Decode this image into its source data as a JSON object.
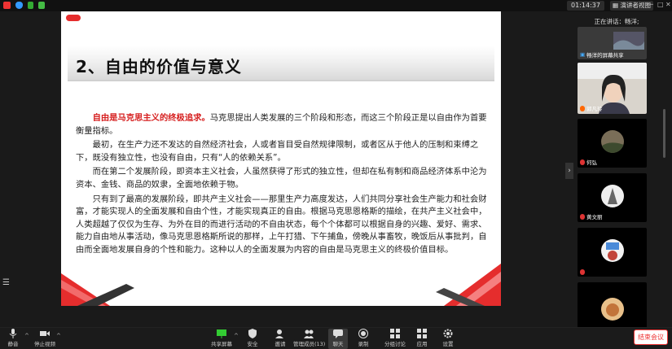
{
  "status_bar": {
    "clock": "01:14:37",
    "view_button": "演讲者视图",
    "window_controls": [
      "─",
      "□",
      "✕"
    ]
  },
  "slide": {
    "title": "2、自由的价值与意义",
    "paragraphs": [
      {
        "highlight": "自由是马克思主义的终极追求。",
        "text": "马克思提出人类发展的三个阶段和形态，而这三个阶段正是以自由作为首要衡量指标。"
      },
      {
        "highlight": "",
        "text": "最初，在生产力还不发达的自然经济社会，人或者盲目受自然规律限制，或者区从于他人的压制和束缚之下，既没有独立性，也没有自由，只有“人的依赖关系”。"
      },
      {
        "highlight": "",
        "text": "而在第二个发展阶段，即资本主义社会，人虽然获得了形式的独立性，但却在私有制和商品经济体系中沦为资本、金钱、商品的奴隶，全面地依赖于物。"
      },
      {
        "highlight": "",
        "text": "只有到了最高的发展阶段，即共产主义社会——那里生产力高度发达，人们共同分享社会生产能力和社会财富，才能实现人的全面发展和自由个性，才能实现真正的自由。根据马克思恩格斯的描绘，在共产主义社会中，人类超越了仅仅为生存、为外在目的而进行活动的不自由状态，每个个体都可以根据自身的兴趣、爱好、需求、能力自由地从事活动，像马克思恩格斯所说的那样，上午打猎、下午捕鱼，傍晚从事畜牧，晚饭后从事批判，自由而全面地发展自身的个性和能力。这种以人的全面发展为内容的自由是马克思主义的终极价值目标。"
      }
    ]
  },
  "right_panel": {
    "speaking_label": "正在讲话：畅洋;",
    "tiles": [
      {
        "name": "畅洋的屏幕共享"
      },
      {
        "name": "郭凡玲"
      },
      {
        "name": "何弘"
      },
      {
        "name": "黄文丽"
      },
      {
        "name": ""
      },
      {
        "name": "尚峰"
      },
      {
        "name": ""
      }
    ]
  },
  "toolbar": {
    "mute": "静音",
    "stop_video": "停止视频",
    "share": "共享屏幕",
    "security": "安全",
    "invite": "邀请",
    "participants": "管理成员(13)",
    "chat": "聊天",
    "record": "录制",
    "breakout": "分组讨论",
    "apps": "应用",
    "settings": "设置",
    "end_meeting": "结束会议"
  },
  "colors": {
    "accent_red": "#d61f1f",
    "end_red": "#e33333"
  }
}
